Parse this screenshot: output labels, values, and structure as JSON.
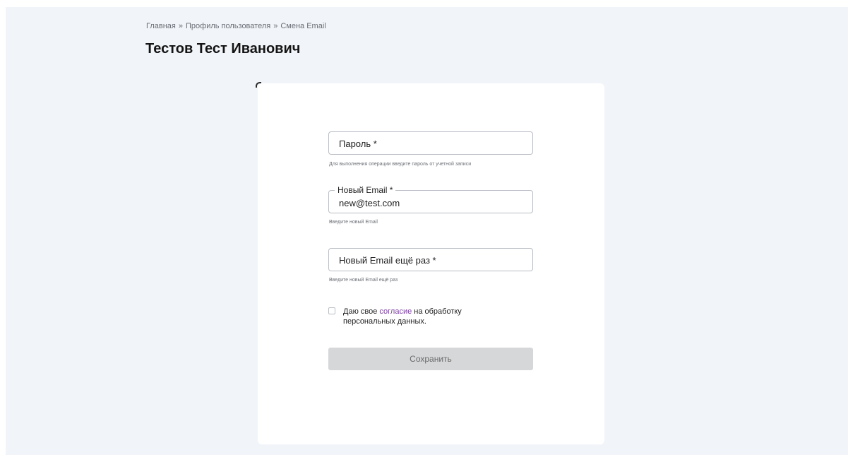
{
  "breadcrumb": {
    "items": [
      "Главная",
      "Профиль пользователя",
      "Смена Email"
    ],
    "separator": "»"
  },
  "page": {
    "title": "Тестов Тест Иванович"
  },
  "form": {
    "password": {
      "label": "Пароль *",
      "value": "",
      "hint": "Для выполнения операции введите пароль от учетной записи"
    },
    "new_email": {
      "label": "Новый Email *",
      "value": "new@test.com",
      "hint": "Введите новый Email"
    },
    "new_email_repeat": {
      "label": "Новый Email ещё раз *",
      "value": "",
      "hint": "Введите новый Email ещё раз"
    },
    "consent": {
      "checked": false,
      "text_before": "Даю свое ",
      "link_text": "согласие",
      "text_after": " на обработку персональных данных."
    },
    "submit_label": "Сохранить"
  },
  "colors": {
    "page_background": "#f1f4f8",
    "card_background": "#ffffff",
    "link": "#7b3fa0",
    "button_disabled": "#d6d7d9"
  }
}
